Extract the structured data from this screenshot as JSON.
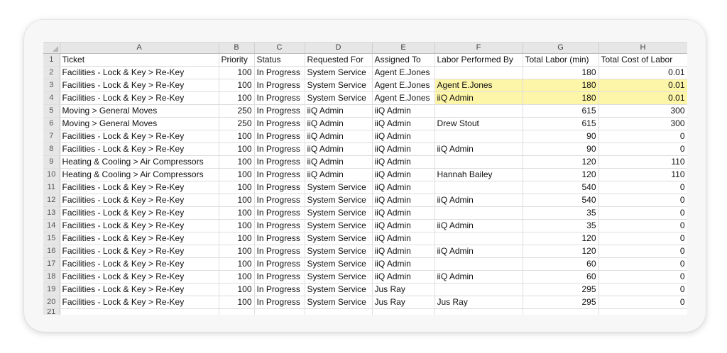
{
  "columns": [
    "A",
    "B",
    "C",
    "D",
    "E",
    "F",
    "G",
    "H"
  ],
  "headers": [
    "Ticket",
    "Priority",
    "Status",
    "Requested For",
    "Assigned To",
    "Labor Performed By",
    "Total Labor (min)",
    "Total Cost of Labor"
  ],
  "rows": [
    {
      "n": "2",
      "ticket": "Facilities - Lock & Key > Re-Key",
      "priority": "100",
      "status": "In Progress",
      "requested_for": "System Service",
      "assigned_to": "Agent E.Jones",
      "labor_by": "",
      "labor_min": "180",
      "cost": "0.01",
      "highlight": false
    },
    {
      "n": "3",
      "ticket": "Facilities - Lock & Key > Re-Key",
      "priority": "100",
      "status": "In Progress",
      "requested_for": "System Service",
      "assigned_to": "Agent E.Jones",
      "labor_by": "Agent E.Jones",
      "labor_min": "180",
      "cost": "0.01",
      "highlight": true
    },
    {
      "n": "4",
      "ticket": "Facilities - Lock & Key > Re-Key",
      "priority": "100",
      "status": "In Progress",
      "requested_for": "System Service",
      "assigned_to": "Agent E.Jones",
      "labor_by": "iiQ Admin",
      "labor_min": "180",
      "cost": "0.01",
      "highlight": true
    },
    {
      "n": "5",
      "ticket": "Moving > General Moves",
      "priority": "250",
      "status": "In Progress",
      "requested_for": "iiQ Admin",
      "assigned_to": "iiQ Admin",
      "labor_by": "",
      "labor_min": "615",
      "cost": "300",
      "highlight": false
    },
    {
      "n": "6",
      "ticket": "Moving > General Moves",
      "priority": "250",
      "status": "In Progress",
      "requested_for": "iiQ Admin",
      "assigned_to": "iiQ Admin",
      "labor_by": "Drew Stout",
      "labor_min": "615",
      "cost": "300",
      "highlight": false
    },
    {
      "n": "7",
      "ticket": "Facilities - Lock & Key > Re-Key",
      "priority": "100",
      "status": "In Progress",
      "requested_for": "iiQ Admin",
      "assigned_to": "iiQ Admin",
      "labor_by": "",
      "labor_min": "90",
      "cost": "0",
      "highlight": false
    },
    {
      "n": "8",
      "ticket": "Facilities - Lock & Key > Re-Key",
      "priority": "100",
      "status": "In Progress",
      "requested_for": "iiQ Admin",
      "assigned_to": "iiQ Admin",
      "labor_by": "iiQ Admin",
      "labor_min": "90",
      "cost": "0",
      "highlight": false
    },
    {
      "n": "9",
      "ticket": "Heating & Cooling > Air Compressors",
      "priority": "100",
      "status": "In Progress",
      "requested_for": "iiQ Admin",
      "assigned_to": "iiQ Admin",
      "labor_by": "",
      "labor_min": "120",
      "cost": "110",
      "highlight": false
    },
    {
      "n": "10",
      "ticket": "Heating & Cooling > Air Compressors",
      "priority": "100",
      "status": "In Progress",
      "requested_for": "iiQ Admin",
      "assigned_to": "iiQ Admin",
      "labor_by": "Hannah Bailey",
      "labor_min": "120",
      "cost": "110",
      "highlight": false
    },
    {
      "n": "11",
      "ticket": "Facilities - Lock & Key > Re-Key",
      "priority": "100",
      "status": "In Progress",
      "requested_for": "System Service",
      "assigned_to": "iiQ Admin",
      "labor_by": "",
      "labor_min": "540",
      "cost": "0",
      "highlight": false
    },
    {
      "n": "12",
      "ticket": "Facilities - Lock & Key > Re-Key",
      "priority": "100",
      "status": "In Progress",
      "requested_for": "System Service",
      "assigned_to": "iiQ Admin",
      "labor_by": "iiQ Admin",
      "labor_min": "540",
      "cost": "0",
      "highlight": false
    },
    {
      "n": "13",
      "ticket": "Facilities - Lock & Key > Re-Key",
      "priority": "100",
      "status": "In Progress",
      "requested_for": "System Service",
      "assigned_to": "iiQ Admin",
      "labor_by": "",
      "labor_min": "35",
      "cost": "0",
      "highlight": false
    },
    {
      "n": "14",
      "ticket": "Facilities - Lock & Key > Re-Key",
      "priority": "100",
      "status": "In Progress",
      "requested_for": "System Service",
      "assigned_to": "iiQ Admin",
      "labor_by": "iiQ Admin",
      "labor_min": "35",
      "cost": "0",
      "highlight": false
    },
    {
      "n": "15",
      "ticket": "Facilities - Lock & Key > Re-Key",
      "priority": "100",
      "status": "In Progress",
      "requested_for": "System Service",
      "assigned_to": "iiQ Admin",
      "labor_by": "",
      "labor_min": "120",
      "cost": "0",
      "highlight": false
    },
    {
      "n": "16",
      "ticket": "Facilities - Lock & Key > Re-Key",
      "priority": "100",
      "status": "In Progress",
      "requested_for": "System Service",
      "assigned_to": "iiQ Admin",
      "labor_by": "iiQ Admin",
      "labor_min": "120",
      "cost": "0",
      "highlight": false
    },
    {
      "n": "17",
      "ticket": "Facilities - Lock & Key > Re-Key",
      "priority": "100",
      "status": "In Progress",
      "requested_for": "System Service",
      "assigned_to": "iiQ Admin",
      "labor_by": "",
      "labor_min": "60",
      "cost": "0",
      "highlight": false
    },
    {
      "n": "18",
      "ticket": "Facilities - Lock & Key > Re-Key",
      "priority": "100",
      "status": "In Progress",
      "requested_for": "System Service",
      "assigned_to": "iiQ Admin",
      "labor_by": "iiQ Admin",
      "labor_min": "60",
      "cost": "0",
      "highlight": false
    },
    {
      "n": "19",
      "ticket": "Facilities - Lock & Key > Re-Key",
      "priority": "100",
      "status": "In Progress",
      "requested_for": "System Service",
      "assigned_to": "Jus Ray",
      "labor_by": "",
      "labor_min": "295",
      "cost": "0",
      "highlight": false
    },
    {
      "n": "20",
      "ticket": "Facilities - Lock & Key > Re-Key",
      "priority": "100",
      "status": "In Progress",
      "requested_for": "System Service",
      "assigned_to": "Jus Ray",
      "labor_by": "Jus Ray",
      "labor_min": "295",
      "cost": "0",
      "highlight": false
    }
  ],
  "row_numbers": {
    "header": "1",
    "partial": "21"
  },
  "colors": {
    "highlight": "#fdf6a8",
    "header_bg": "#e6e6e6",
    "grid": "#dedede"
  }
}
